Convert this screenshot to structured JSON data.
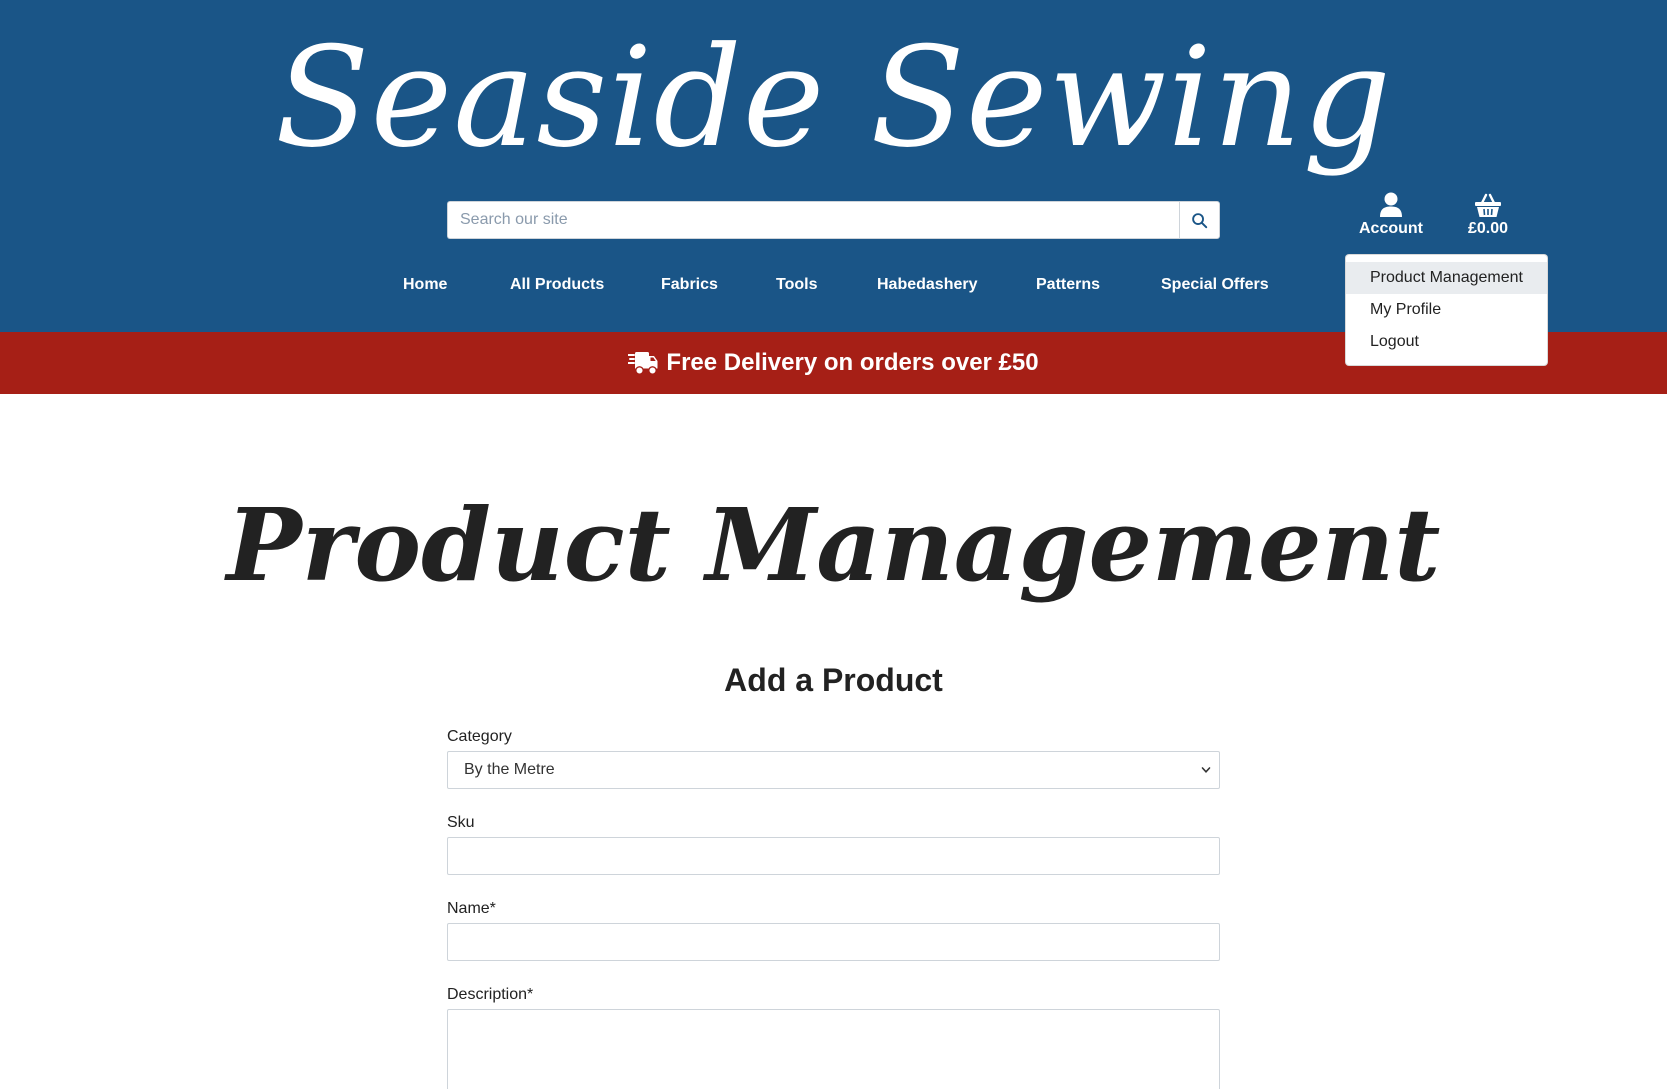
{
  "header": {
    "logo_text": "Seaside Sewing",
    "search": {
      "placeholder": "Search our site",
      "value": "",
      "icon": "search-icon"
    },
    "account": {
      "label": "Account",
      "icon": "user-icon"
    },
    "basket": {
      "total": "£0.00",
      "icon": "basket-icon"
    },
    "nav": [
      "Home",
      "All Products",
      "Fabrics",
      "Tools",
      "Habedashery",
      "Patterns",
      "Special Offers"
    ],
    "account_menu": {
      "items": [
        "Product Management",
        "My Profile",
        "Logout"
      ],
      "active_index": 0
    }
  },
  "banner": {
    "icon": "truck-fast-icon",
    "text": "Free Delivery on orders over £50"
  },
  "main": {
    "page_title": "Product Management",
    "section_title": "Add a Product",
    "form": {
      "category_label": "Category",
      "category_value": "By the Metre",
      "sku_label": "Sku",
      "sku_value": "",
      "name_label": "Name*",
      "name_value": "",
      "description_label": "Description*",
      "description_value": ""
    }
  },
  "colors": {
    "header_bg": "#1a5587",
    "banner_bg": "#a61f16",
    "text": "#222222",
    "dropdown_active_bg": "#e9ecef"
  }
}
